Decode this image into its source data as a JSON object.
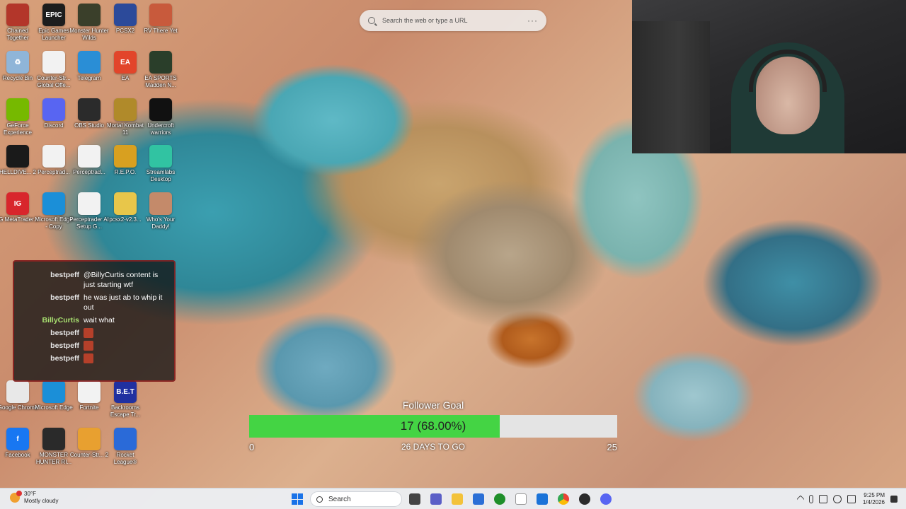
{
  "desktop": {
    "icons": [
      {
        "label": "Chained Together",
        "color": "#b3362a",
        "glyph": ""
      },
      {
        "label": "Epic Games Launcher",
        "color": "#1d1d1d",
        "glyph": "EPIC"
      },
      {
        "label": "Monster Hunter Wilds",
        "color": "#3a3f2a",
        "glyph": ""
      },
      {
        "label": "PCSX2",
        "color": "#2c4a9a",
        "glyph": ""
      },
      {
        "label": "RV There Yet",
        "color": "#c85a3c",
        "glyph": ""
      },
      {
        "label": "Recycle Bin",
        "color": "#8fb5d8",
        "glyph": "♻"
      },
      {
        "label": "Counter-Str... Global Offe...",
        "color": "#f2f2f2",
        "glyph": ""
      },
      {
        "label": "Telegram",
        "color": "#2a8ed6",
        "glyph": ""
      },
      {
        "label": "EA",
        "color": "#e2452a",
        "glyph": "EA"
      },
      {
        "label": "EA SPORTS Madden N...",
        "color": "#2a3e2a",
        "glyph": ""
      },
      {
        "label": "GeForce Experience",
        "color": "#76b900",
        "glyph": ""
      },
      {
        "label": "Discord",
        "color": "#5865f2",
        "glyph": ""
      },
      {
        "label": "OBS Studio",
        "color": "#2b2b2b",
        "glyph": ""
      },
      {
        "label": "Mortal Kombat 11",
        "color": "#b08a2a",
        "glyph": ""
      },
      {
        "label": "Undercroft warriors",
        "color": "#111111",
        "glyph": ""
      },
      {
        "label": "HELLDIVE... 2",
        "color": "#1a1a1a",
        "glyph": ""
      },
      {
        "label": "Perceptrad...",
        "color": "#f2f2f2",
        "glyph": ""
      },
      {
        "label": "Perceptrad...",
        "color": "#f2f2f2",
        "glyph": ""
      },
      {
        "label": "R.E.P.O.",
        "color": "#d8a020",
        "glyph": ""
      },
      {
        "label": "Streamlabs Desktop",
        "color": "#31c3a2",
        "glyph": ""
      },
      {
        "label": "IG MetaTrader...",
        "color": "#d8262c",
        "glyph": "IG"
      },
      {
        "label": "Microsoft Edge - Copy",
        "color": "#1b8fd8",
        "glyph": ""
      },
      {
        "label": "Perceptrader AI Setup G...",
        "color": "#f2f2f2",
        "glyph": ""
      },
      {
        "label": "pcsx2-v2.3...",
        "color": "#e8c64a",
        "glyph": ""
      },
      {
        "label": "Who's Your Daddy!",
        "color": "#c48a6a",
        "glyph": ""
      },
      {
        "label": "Google Chrome",
        "color": "#e8e8e8",
        "glyph": ""
      },
      {
        "label": "Microsoft Edge",
        "color": "#1b8fd8",
        "glyph": ""
      },
      {
        "label": "Fortnite",
        "color": "#f2f2f2",
        "glyph": ""
      },
      {
        "label": "Backrooms Escape Tr...",
        "color": "#2030a0",
        "glyph": "B.E.T"
      },
      {
        "label": "Facebook",
        "color": "#1877f2",
        "glyph": "f"
      },
      {
        "label": "MONSTER HUNTER RI...",
        "color": "#2a2a2a",
        "glyph": ""
      },
      {
        "label": "Counter-Str... 2",
        "color": "#e8a030",
        "glyph": ""
      },
      {
        "label": "Rocket League®",
        "color": "#2a6ad8",
        "glyph": ""
      }
    ]
  },
  "browser_search": {
    "placeholder": "Search the web or type a URL",
    "more": "···"
  },
  "chat": {
    "messages": [
      {
        "user": "bestpeff",
        "text": "@BillyCurtis content is just starting wtf",
        "emote": false,
        "green": false
      },
      {
        "user": "bestpeff",
        "text": "he was just ab to whip it out",
        "emote": false,
        "green": false
      },
      {
        "user": "BillyCurtis",
        "text": "wait what",
        "emote": false,
        "green": true
      },
      {
        "user": "bestpeff",
        "text": "",
        "emote": true,
        "green": false
      },
      {
        "user": "bestpeff",
        "text": "",
        "emote": true,
        "green": false
      },
      {
        "user": "bestpeff",
        "text": "",
        "emote": true,
        "green": false
      }
    ]
  },
  "follower_goal": {
    "title": "Follower Goal",
    "progress_text": "17 (68.00%)",
    "current": 17,
    "target": 25,
    "percent": 68,
    "min_label": "0",
    "max_label": "25",
    "days_left": "26 DAYS TO GO",
    "fill_color": "#44d444"
  },
  "taskbar": {
    "weather_temp": "30°F",
    "weather_desc": "Mostly cloudy",
    "search_label": "Search",
    "time": "9:25 PM",
    "date": "1/4/2026"
  }
}
